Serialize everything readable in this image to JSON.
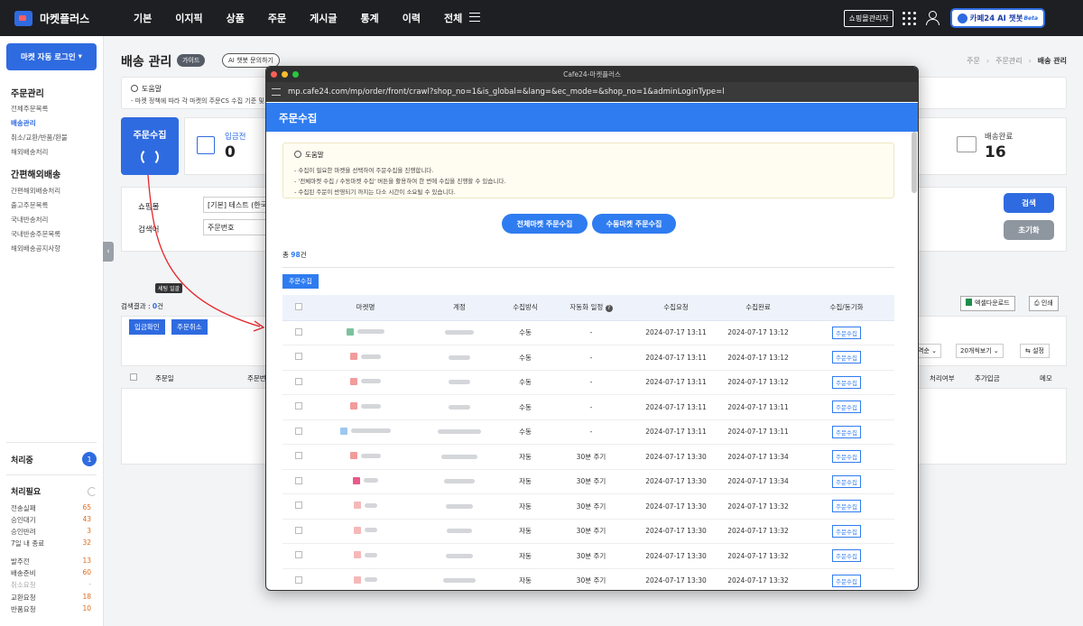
{
  "topnav": {
    "brand": "마켓플러스",
    "menu": [
      "기본",
      "이지픽",
      "상품",
      "주문",
      "게시글",
      "통계",
      "이력",
      "전체"
    ],
    "shop_admin": "쇼핑몰관리자",
    "ai_chat": "카페24 AI 챗봇",
    "ai_beta": "Beta"
  },
  "sidebar": {
    "login_btn": "마켓 자동 로그인",
    "section_order": "주문관리",
    "order_links": [
      "전체주문목록",
      "배송관리",
      "취소/교환/반품/환불",
      "해외배송처리"
    ],
    "section_overseas": "간편해외배송",
    "overseas_links": [
      "간편해외배송처리",
      "출고주문목록",
      "국내반송처리",
      "국내반송주문목록",
      "해외배송공지사항"
    ],
    "processing_title": "처리중",
    "processing_count": "1",
    "needed_title": "처리필요",
    "stats_a": [
      {
        "label": "전송실패",
        "value": "65"
      },
      {
        "label": "승인대기",
        "value": "43"
      },
      {
        "label": "승인반려",
        "value": "3"
      },
      {
        "label": "7일 내 종료",
        "value": "32"
      }
    ],
    "stats_b": [
      {
        "label": "발주전",
        "value": "13"
      },
      {
        "label": "배송준비",
        "value": "60"
      },
      {
        "label": "취소요청",
        "value": "-"
      },
      {
        "label": "교환요청",
        "value": "18"
      },
      {
        "label": "반품요청",
        "value": "10"
      }
    ]
  },
  "main": {
    "title": "배송 관리",
    "guide": "가이드",
    "ai_ask": "AI 챗봇 문의하기",
    "crumbs": [
      "주문",
      "주문관리",
      "배송 관리"
    ],
    "help_title": "도움말",
    "help_desc": "- 마켓 정책에 따라 각 마켓의 주문CS 수집 기준 및",
    "collect_card": "주문수집",
    "wait_label": "입금전",
    "wait_value": "0",
    "done_label": "배송완료",
    "done_value": "16",
    "mall_label": "쇼핑몰",
    "mall_value": "[기본] 테스트 (한국",
    "keyword_label": "검색어",
    "keyword_value": "주문번호",
    "search_btn": "검색",
    "reset_btn": "초기화",
    "tooltip": "세팅 일괄",
    "result_label": "검색결과 : ",
    "result_count": "0",
    "result_unit": "건",
    "confirm_btn": "입금확인",
    "cancel_btn": "주문취소",
    "excel_btn": "엑셀다운로드",
    "print_btn": "인쇄",
    "sort_select": "역순",
    "per_page_select": "20개씩보기",
    "settings_btn": "설정",
    "table_cols": [
      "주문일",
      "주문번",
      "처리여부",
      "추가입금",
      "메모"
    ]
  },
  "popup": {
    "window_title": "Cafe24-마켓플러스",
    "url": "mp.cafe24.com/mp/order/front/crawl?shop_no=1&is_global=&lang=&ec_mode=&shop_no=1&adminLoginType=l",
    "header": "주문수집",
    "help_title": "도움말",
    "help_lines": [
      "- 수집이 필요한 마켓을 선택하여 주문수집을 진행합니다.",
      "- '전체마켓 수집 / 수동마켓 수집' 버튼을 활용하여 한 번에 수집을 진행할 수 있습니다.",
      "- 수집된 주문이 반영되기 까지는 다소 시간이 소요될 수 있습니다."
    ],
    "btn_all": "전체마켓 주문수집",
    "btn_manual": "수동마켓 주문수집",
    "total_prefix": "총 ",
    "total_count": "98",
    "total_unit": "건",
    "collect_btn": "주문수집",
    "columns": [
      "마켓명",
      "계정",
      "수집방식",
      "자동화 일정",
      "수집요청",
      "수집완료",
      "수집/동기화"
    ],
    "rows": [
      {
        "method": "수동",
        "schedule": "-",
        "req": "2024-07-17 13:11",
        "done": "2024-07-17 13:12",
        "action": "주문수집"
      },
      {
        "method": "수동",
        "schedule": "-",
        "req": "2024-07-17 13:11",
        "done": "2024-07-17 13:12",
        "action": "주문수집"
      },
      {
        "method": "수동",
        "schedule": "-",
        "req": "2024-07-17 13:11",
        "done": "2024-07-17 13:12",
        "action": "주문수집"
      },
      {
        "method": "수동",
        "schedule": "-",
        "req": "2024-07-17 13:11",
        "done": "2024-07-17 13:11",
        "action": "주문수집"
      },
      {
        "method": "수동",
        "schedule": "-",
        "req": "2024-07-17 13:11",
        "done": "2024-07-17 13:11",
        "action": "주문수집"
      },
      {
        "method": "자동",
        "schedule": "30분 주기",
        "req": "2024-07-17 13:30",
        "done": "2024-07-17 13:34",
        "action": "주문수집"
      },
      {
        "method": "자동",
        "schedule": "30분 주기",
        "req": "2024-07-17 13:30",
        "done": "2024-07-17 13:34",
        "action": "주문수집"
      },
      {
        "method": "자동",
        "schedule": "30분 주기",
        "req": "2024-07-17 13:30",
        "done": "2024-07-17 13:32",
        "action": "주문수집"
      },
      {
        "method": "자동",
        "schedule": "30분 주기",
        "req": "2024-07-17 13:30",
        "done": "2024-07-17 13:32",
        "action": "주문수집"
      },
      {
        "method": "자동",
        "schedule": "30분 주기",
        "req": "2024-07-17 13:30",
        "done": "2024-07-17 13:32",
        "action": "주문수집"
      },
      {
        "method": "자동",
        "schedule": "30분 주기",
        "req": "2024-07-17 13:30",
        "done": "2024-07-17 13:32",
        "action": "주문수집"
      }
    ]
  },
  "colors": {
    "accent": "#2f6be0",
    "popup_header": "#2f7cf0",
    "nav_bg": "#1e1f22",
    "warn": "#e06c1b"
  }
}
